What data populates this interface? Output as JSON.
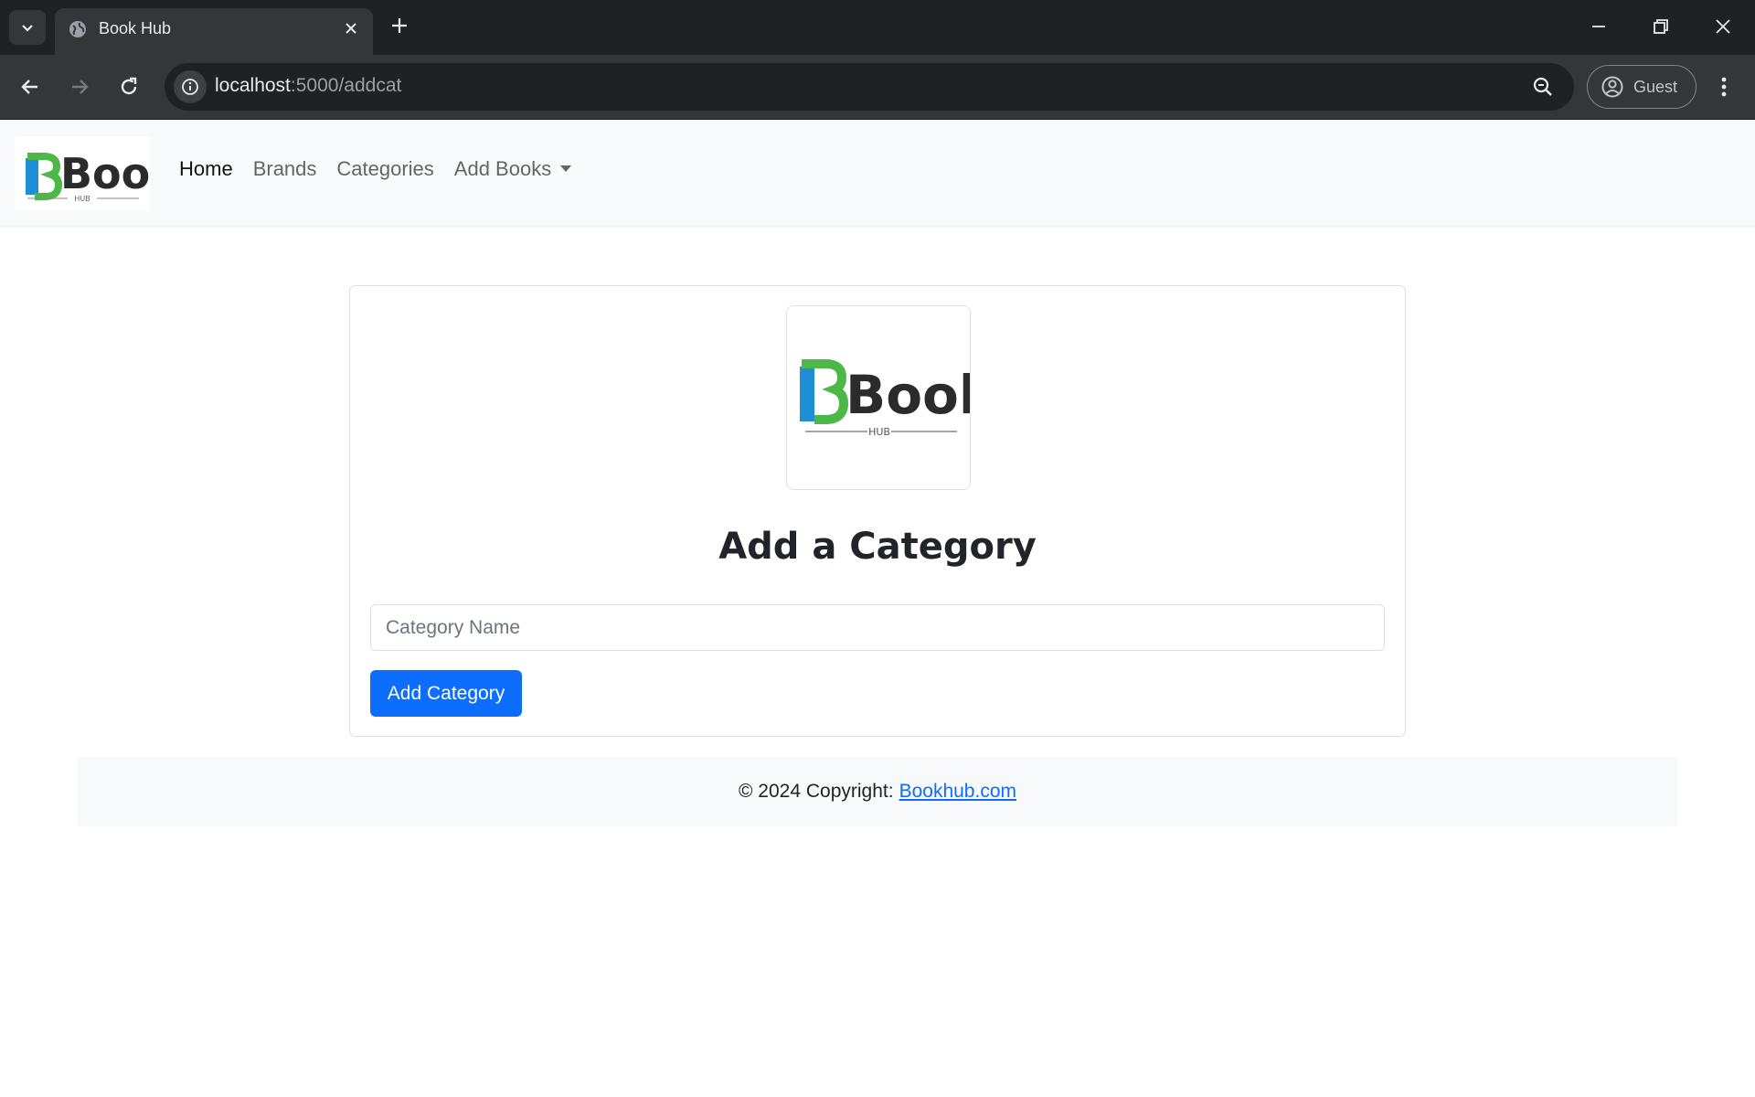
{
  "browser": {
    "tab_title": "Book Hub",
    "url_host": "localhost",
    "url_rest": ":5000/addcat",
    "profile_label": "Guest",
    "icons": {
      "tab_list": "chevron-down-icon",
      "favicon": "globe-icon",
      "tab_close": "close-icon",
      "new_tab": "plus-icon",
      "back": "arrow-left-icon",
      "forward": "arrow-right-icon",
      "reload": "reload-icon",
      "site_info": "info-icon",
      "zoom": "zoom-icon",
      "profile": "account-icon",
      "menu": "more-vertical-icon"
    }
  },
  "logo": {
    "main": "Book",
    "sub": "HUB"
  },
  "nav": {
    "items": [
      {
        "label": "Home",
        "active": true
      },
      {
        "label": "Brands",
        "active": false
      },
      {
        "label": "Categories",
        "active": false
      },
      {
        "label": "Add Books",
        "active": false,
        "dropdown": true
      }
    ]
  },
  "form": {
    "title": "Add a Category",
    "input_placeholder": "Category Name",
    "input_value": "",
    "submit_label": "Add Category"
  },
  "footer": {
    "text": "© 2024 Copyright:",
    "link_text": "Bookhub.com"
  },
  "colors": {
    "primary": "#0d6efd",
    "logo_green": "#4cb848",
    "logo_blue": "#1e8fd6",
    "logo_dark": "#2b2b2b"
  }
}
